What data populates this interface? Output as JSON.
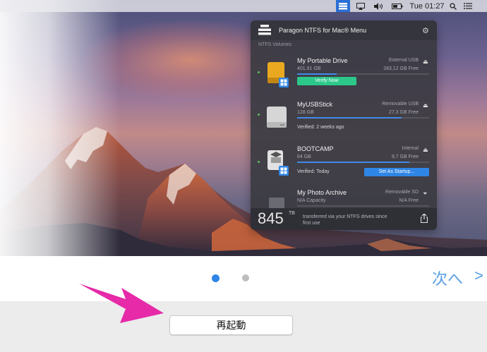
{
  "menubar": {
    "clock": "Tue 01:27"
  },
  "panel": {
    "title": "Paragon NTFS for Mac® Menu",
    "section_label": "NTFS Volumes",
    "volumes": [
      {
        "name": "My Portable Drive",
        "type": "External USB",
        "size": "401,91 GB",
        "free": "283,12 GB Free",
        "usage_fraction": 0.3,
        "action": "Verify Now"
      },
      {
        "name": "MyUSBStick",
        "type": "Removable USB",
        "size": "128 GB",
        "free": "27,3 GB Free",
        "usage_fraction": 0.79,
        "status": "Verified: 2 weeks ago"
      },
      {
        "name": "BOOTCAMP",
        "type": "Internal",
        "size": "64 GB",
        "free": "9,7 GB Free",
        "usage_fraction": 0.85,
        "status": "Verified: Today",
        "action": "Set As Startup..."
      },
      {
        "name": "My Photo Archive",
        "type": "Removable SD",
        "size": "N/A Capacity",
        "free": "N/A Free"
      }
    ],
    "footer": {
      "count": "845",
      "unit": "TB",
      "text": "transferred via your NTFS drives since first use"
    }
  },
  "installer": {
    "next_label": "次へ",
    "next_chevron": ">",
    "restart_label": "再起動"
  },
  "colors": {
    "accent_blue": "#2f86e6",
    "verify_green": "#2cc88a",
    "arrow_magenta": "#e62aa8"
  }
}
